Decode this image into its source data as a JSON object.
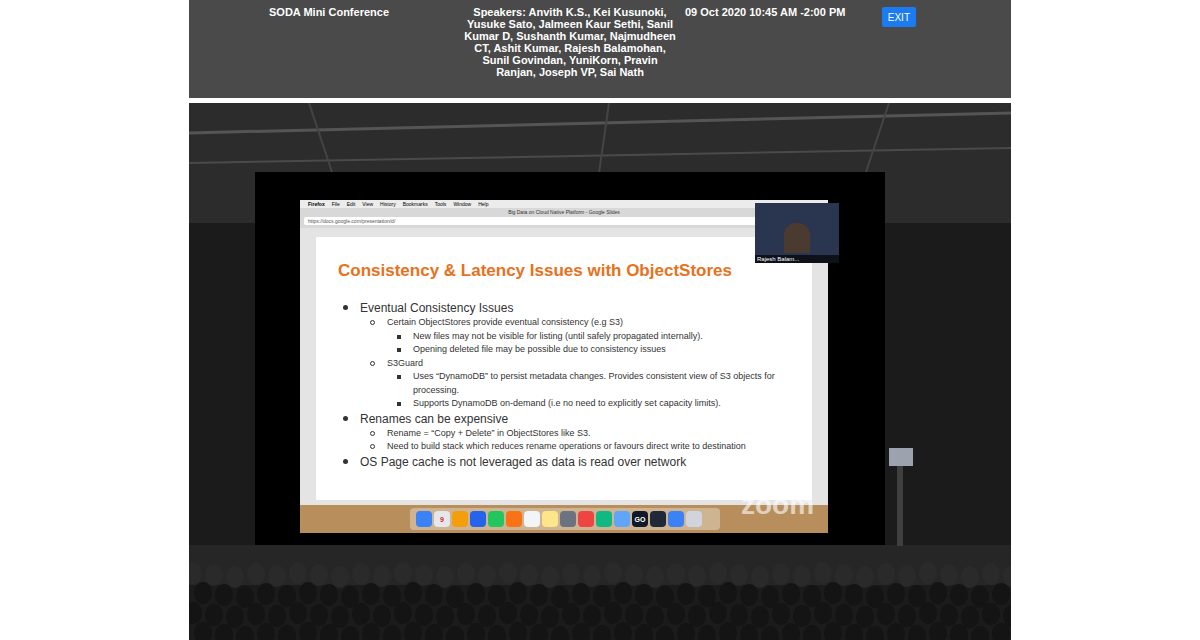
{
  "header": {
    "title": "SODA Mini Conference",
    "speakers": "Speakers: Anvith K.S., Kei Kusunoki, Yusuke Sato, Jalmeen Kaur Sethi, Sanil Kumar D, Sushanth Kumar, Najmudheen CT, Ashit Kumar, Rajesh Balamohan, Sunil Govindan, YuniKorn, Pravin Ranjan, Joseph VP, Sai Nath",
    "datetime": "09 Oct 2020 10:45 AM -2:00 PM",
    "exit_button": "EXIT"
  },
  "screen_share": {
    "menu_bar": [
      "Firefox",
      "File",
      "Edit",
      "View",
      "History",
      "Bookmarks",
      "Tools",
      "Window",
      "Help"
    ],
    "browser": {
      "title": "Big Data on Cloud Native Platform - Google Slides",
      "url": "https://docs.google.com/presentation/d/"
    },
    "slide": {
      "title": "Consistency & Latency Issues with ObjectStores",
      "bullets": [
        {
          "text": "Eventual Consistency Issues",
          "children": [
            {
              "text": "Certain ObjectStores provide eventual consistency (e.g S3)",
              "children": [
                {
                  "text": "New files may not be visible for listing (until safely propagated internally).",
                  "children": []
                },
                {
                  "text": "Opening deleted file may be possible due to consistency issues",
                  "children": []
                }
              ]
            },
            {
              "text": "S3Guard",
              "children": [
                {
                  "text": "Uses “DynamoDB” to persist metadata changes. Provides consistent view of S3 objects for processing.",
                  "children": []
                },
                {
                  "text": "Supports DynamoDB on-demand (i.e no need to explicitly set capacity limits).",
                  "children": []
                }
              ]
            }
          ]
        },
        {
          "text": "Renames can be expensive",
          "children": [
            {
              "text": "Rename = “Copy + Delete” in ObjectStores like S3.",
              "children": []
            },
            {
              "text": "Need to build stack which reduces rename operations or favours direct write to destination",
              "children": []
            }
          ]
        },
        {
          "text": "OS Page cache is not leveraged as data is read over network",
          "children": []
        }
      ]
    },
    "dock_labels": {
      "calendar": "9",
      "goland": "GO"
    },
    "video": {
      "name": "Rajesh Balam..."
    },
    "watermark": "zoom"
  }
}
